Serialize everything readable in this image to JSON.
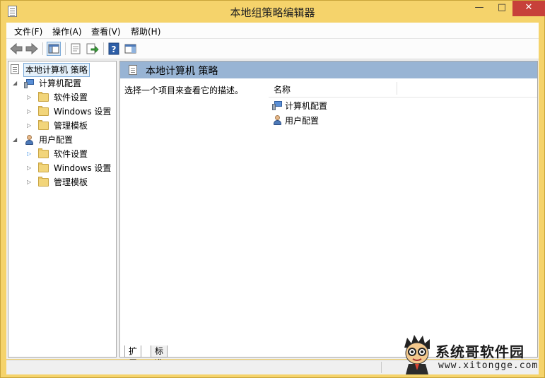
{
  "window": {
    "title": "本地组策略编辑器",
    "controls": {
      "minimize": "—",
      "maximize": "□",
      "close": "✕"
    }
  },
  "menu": [
    "文件(F)",
    "操作(A)",
    "查看(V)",
    "帮助(H)"
  ],
  "toolbar": {
    "icons": [
      "back-icon",
      "forward-icon",
      "show-hide-tree-icon",
      "properties-icon",
      "export-list-icon",
      "help-icon",
      "show-hide-action-pane-icon"
    ]
  },
  "tree": {
    "root": "本地计算机 策略",
    "computer": {
      "label": "计算机配置",
      "children": [
        "软件设置",
        "Windows 设置",
        "管理模板"
      ]
    },
    "user": {
      "label": "用户配置",
      "children": [
        "软件设置",
        "Windows 设置",
        "管理模板"
      ]
    }
  },
  "right_pane": {
    "title": "本地计算机 策略",
    "description": "选择一个项目来查看它的描述。",
    "column_name": "名称",
    "items": [
      "计算机配置",
      "用户配置"
    ]
  },
  "tabs": [
    "扩展",
    "标准"
  ],
  "watermark": {
    "title": "系统哥软件园",
    "url": "www.xitongge.com"
  },
  "colors": {
    "titlebar": "#f5d36b",
    "close_button": "#c7403a",
    "pane_header": "#98b4d4"
  }
}
